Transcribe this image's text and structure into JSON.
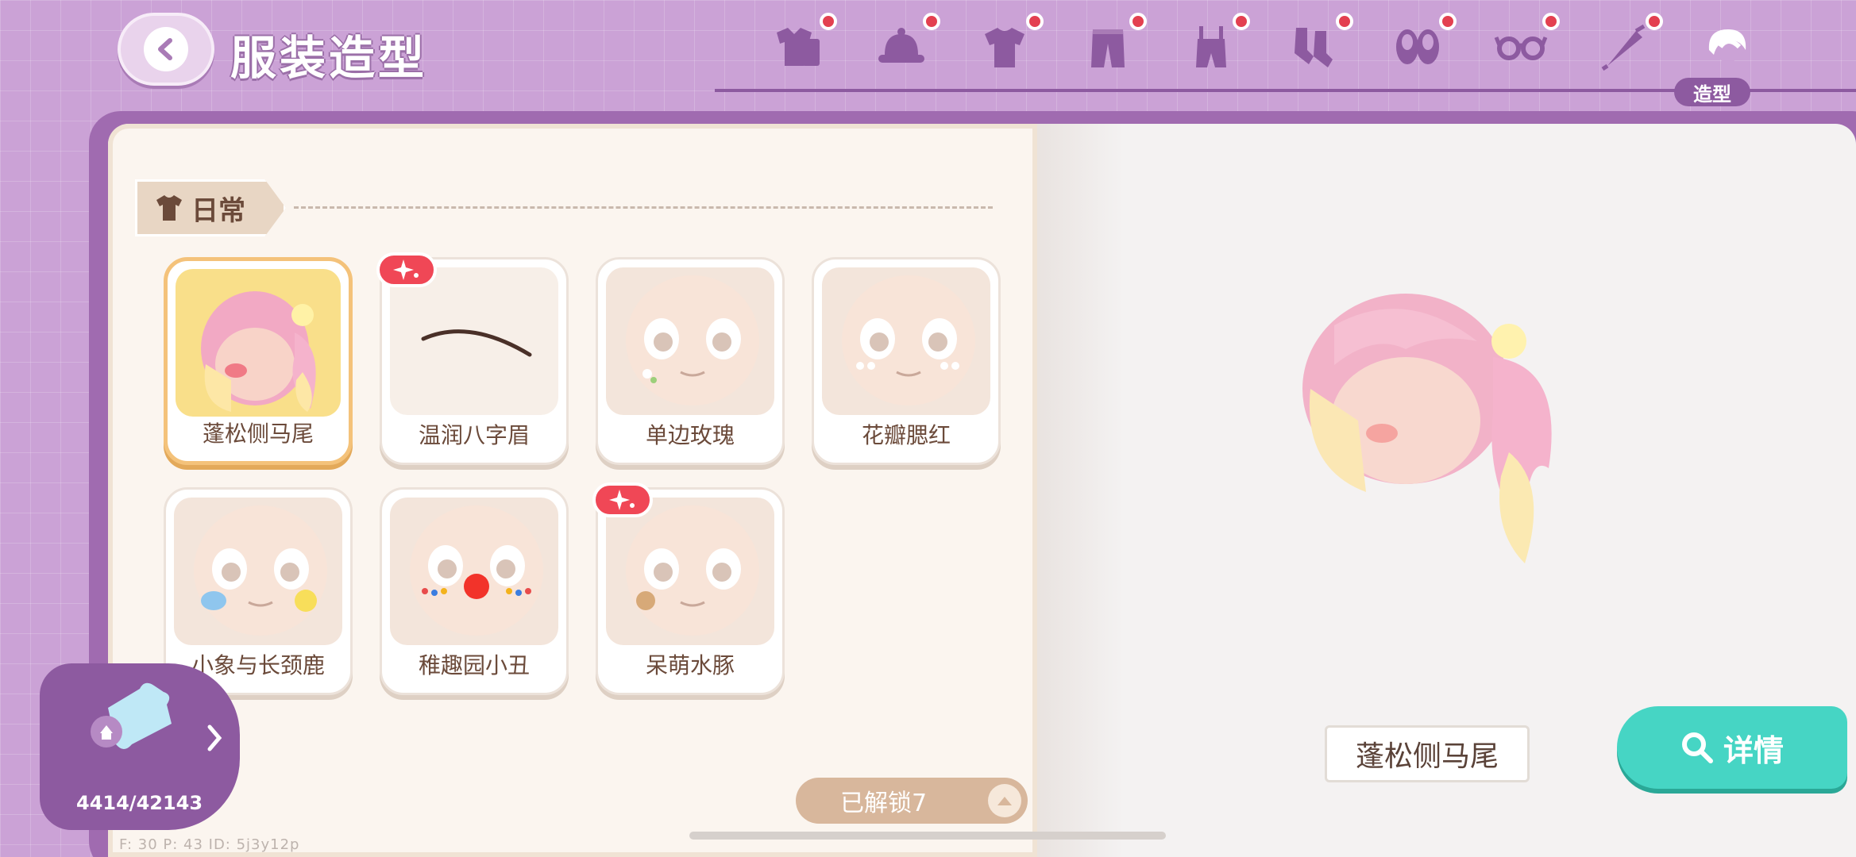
{
  "header": {
    "title": "服装造型",
    "tabs": [
      {
        "icon": "clothes-set-icon",
        "dot": true
      },
      {
        "icon": "hat-icon",
        "dot": true
      },
      {
        "icon": "shirt-icon",
        "dot": true
      },
      {
        "icon": "pants-icon",
        "dot": true
      },
      {
        "icon": "overalls-icon",
        "dot": true
      },
      {
        "icon": "socks-icon",
        "dot": true
      },
      {
        "icon": "shoes-icon",
        "dot": true
      },
      {
        "icon": "glasses-icon",
        "dot": true
      },
      {
        "icon": "umbrella-icon",
        "dot": true
      },
      {
        "icon": "hairstyle-icon",
        "dot": false
      }
    ],
    "active_tab_label": "造型"
  },
  "category": {
    "label": "日常"
  },
  "items": [
    {
      "label": "蓬松侧马尾",
      "selected": true,
      "new": false,
      "kind": "hair"
    },
    {
      "label": "温润八字眉",
      "selected": false,
      "new": true,
      "kind": "brow"
    },
    {
      "label": "单边玫瑰",
      "selected": false,
      "new": false,
      "kind": "face"
    },
    {
      "label": "花瓣腮红",
      "selected": false,
      "new": false,
      "kind": "face"
    },
    {
      "label": "小象与长颈鹿",
      "selected": false,
      "new": false,
      "kind": "face"
    },
    {
      "label": "稚趣园小丑",
      "selected": false,
      "new": false,
      "kind": "clown"
    },
    {
      "label": "呆萌水豚",
      "selected": false,
      "new": true,
      "kind": "face"
    }
  ],
  "collection": {
    "count": "4414/42143"
  },
  "unlock": {
    "label": "已解锁7"
  },
  "preview": {
    "name": "蓬松侧马尾"
  },
  "detail_button": {
    "label": "详情"
  },
  "debug": {
    "text": "F: 30   P: 43   ID: 5j3y12p"
  },
  "colors": {
    "accent_purple": "#8d5aa0",
    "new_red": "#f04756",
    "detail_teal": "#46d5c4",
    "selected_gold": "#f4c27a"
  }
}
